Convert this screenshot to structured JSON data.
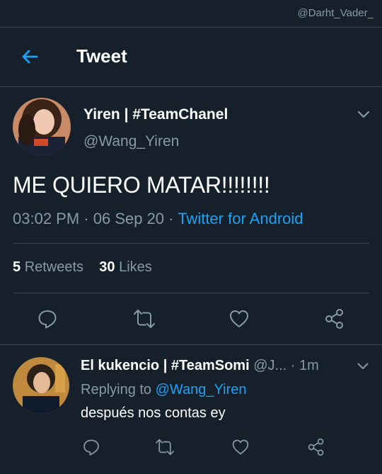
{
  "watermark": "@Darht_Vader_",
  "header": {
    "title": "Tweet"
  },
  "tweet": {
    "display_name": "Yiren | #TeamChanel",
    "handle": "@Wang_Yiren",
    "text": "ME QUIERO MATAR!!!!!!!!",
    "time": "03:02 PM",
    "date": "06 Sep 20",
    "source": "Twitter for Android",
    "retweets_count": "5",
    "retweets_label": "Retweets",
    "likes_count": "30",
    "likes_label": "Likes"
  },
  "reply": {
    "display_name": "El kukencio | #TeamSomi",
    "handle_truncated": "@J...",
    "time_ago": "1m",
    "replying_label": "Replying to",
    "replying_to": "@Wang_Yiren",
    "text": "después nos contas ey"
  },
  "icons": [
    "back-arrow-icon",
    "chevron-down-icon",
    "reply-icon",
    "retweet-icon",
    "like-icon",
    "share-icon"
  ],
  "colors": {
    "background": "#15202b",
    "accent": "#1da1f2",
    "muted": "#8899a6",
    "divider": "#38444d"
  }
}
